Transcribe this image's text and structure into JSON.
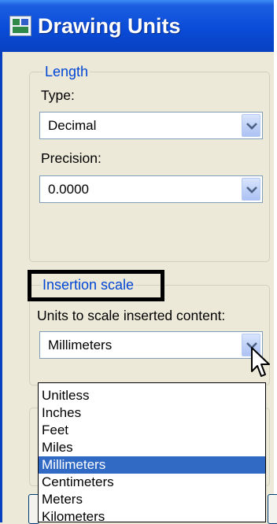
{
  "window": {
    "title": "Drawing Units",
    "title_icon": "drawing-units-icon"
  },
  "length": {
    "legend": "Length",
    "type_label": "Type:",
    "type_value": "Decimal",
    "precision_label": "Precision:",
    "precision_value": "0.0000"
  },
  "insertion_scale": {
    "legend": "Insertion scale",
    "units_label": "Units to scale inserted content:",
    "units_value": "Millimeters",
    "options": [
      "Unitless",
      "Inches",
      "Feet",
      "Miles",
      "Millimeters",
      "Centimeters",
      "Meters",
      "Kilometers"
    ],
    "selected_index": 4
  },
  "colors": {
    "titlebar": "#0a4bd8",
    "legend_text": "#0046d5",
    "selection": "#316ac5",
    "highlight_frame": "#000000"
  },
  "icons": {
    "dropdown": "chevron-down-icon",
    "cursor": "mouse-pointer-icon"
  }
}
